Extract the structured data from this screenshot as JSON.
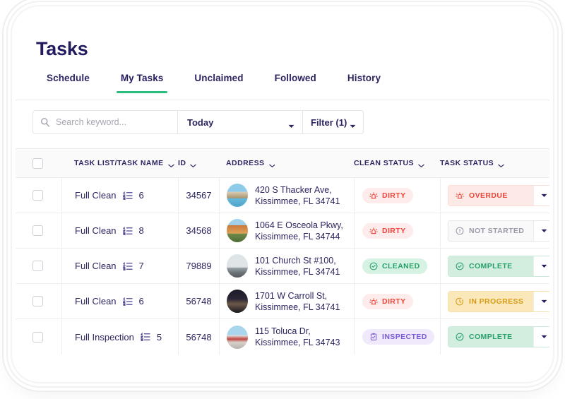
{
  "page": {
    "title": "Tasks"
  },
  "tabs": [
    {
      "label": "Schedule",
      "active": false
    },
    {
      "label": "My Tasks",
      "active": true
    },
    {
      "label": "Unclaimed",
      "active": false
    },
    {
      "label": "Followed",
      "active": false
    },
    {
      "label": "History",
      "active": false
    }
  ],
  "toolbar": {
    "search_placeholder": "Search keyword...",
    "search_value": "",
    "search_icon": "search-icon",
    "date_filter_label": "Today",
    "filter_label": "Filter (1)"
  },
  "table": {
    "columns": [
      {
        "key": "select",
        "label": ""
      },
      {
        "key": "task_name",
        "label": "TASK LIST/TASK NAME"
      },
      {
        "key": "id",
        "label": "ID"
      },
      {
        "key": "address",
        "label": "ADDRESS"
      },
      {
        "key": "clean_status",
        "label": "CLEAN STATUS"
      },
      {
        "key": "task_status",
        "label": "TASK STATUS"
      }
    ],
    "rows": [
      {
        "selected": false,
        "task_name": "Full Clean",
        "task_count": "6",
        "id": "34567",
        "address_line1": "420 S Thacker Ave,",
        "address_line2": "Kissimmee, FL 34741",
        "clean_status": {
          "label": "DIRTY",
          "style": "dirty",
          "icon": "siren-icon"
        },
        "task_status": {
          "label": "OVERDUE",
          "style": "overdue",
          "icon": "siren-icon"
        }
      },
      {
        "selected": false,
        "task_name": "Full Clean",
        "task_count": "8",
        "id": "34568",
        "address_line1": "1064 E Osceola Pkwy,",
        "address_line2": "Kissimmee, FL 34744",
        "clean_status": {
          "label": "DIRTY",
          "style": "dirty",
          "icon": "siren-icon"
        },
        "task_status": {
          "label": "NOT STARTED",
          "style": "notstarted",
          "icon": "info-circle-icon"
        }
      },
      {
        "selected": false,
        "task_name": "Full Clean",
        "task_count": "7",
        "id": "79889",
        "address_line1": "101 Church St #100,",
        "address_line2": "Kissimmee, FL 34741",
        "clean_status": {
          "label": "CLEANED",
          "style": "cleaned",
          "icon": "check-circle-icon"
        },
        "task_status": {
          "label": "COMPLETE",
          "style": "complete",
          "icon": "check-circle-icon"
        }
      },
      {
        "selected": false,
        "task_name": "Full Clean",
        "task_count": "6",
        "id": "56748",
        "address_line1": "1701 W Carroll St,",
        "address_line2": "Kissimmee, FL 34741",
        "clean_status": {
          "label": "DIRTY",
          "style": "dirty",
          "icon": "siren-icon"
        },
        "task_status": {
          "label": "IN PROGRESS",
          "style": "inprogress",
          "icon": "timer-icon"
        }
      },
      {
        "selected": false,
        "task_name": "Full Inspection",
        "task_count": "5",
        "id": "56748",
        "address_line1": "115 Toluca Dr,",
        "address_line2": "Kissimmee, FL 34743",
        "clean_status": {
          "label": "INSPECTED",
          "style": "inspected",
          "icon": "clipboard-check-icon"
        },
        "task_status": {
          "label": "COMPLETE",
          "style": "complete",
          "icon": "check-circle-icon"
        }
      }
    ]
  },
  "colors": {
    "brand_navy": "#221c5e",
    "accent_green": "#2bbd7e",
    "danger_red": "#f0453a",
    "warning_yellow": "#d79b13",
    "purple": "#7c5cd6",
    "muted_grey": "#9a9aa8"
  }
}
